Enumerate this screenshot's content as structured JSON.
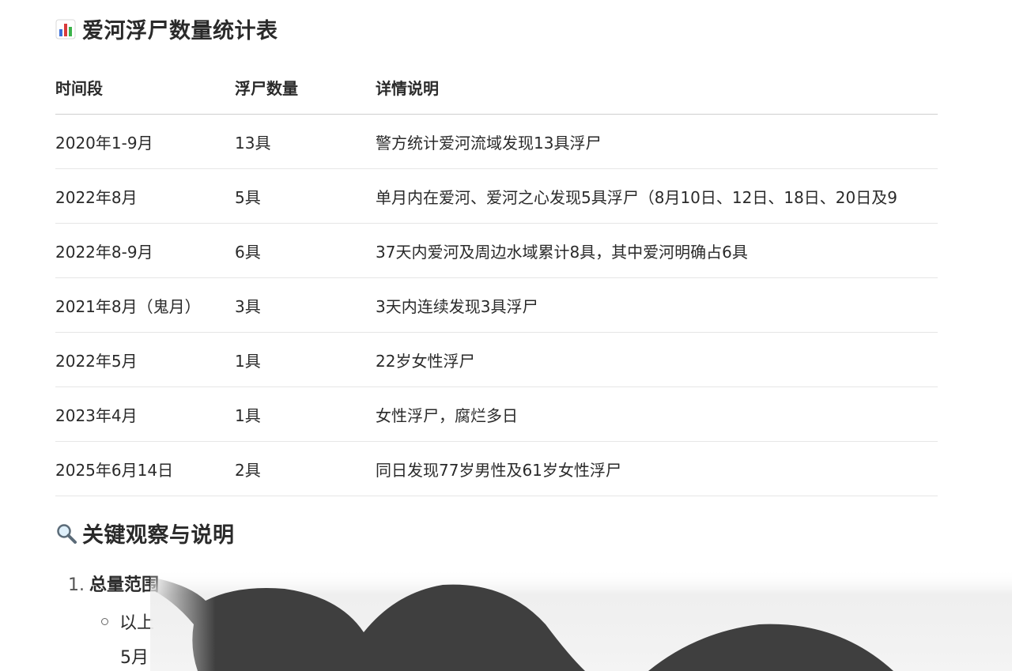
{
  "table_section": {
    "heading": "爱河浮尸数量统计表",
    "columns": [
      "时间段",
      "浮尸数量",
      "详情说明"
    ],
    "rows": [
      {
        "period": "2020年1-9月",
        "count": "13具",
        "detail": "警方统计爱河流域发现13具浮尸"
      },
      {
        "period": "2022年8月",
        "count": "5具",
        "detail": "单月内在爱河、爱河之心发现5具浮尸（8月10日、12日、18日、20日及9"
      },
      {
        "period": "2022年8-9月",
        "count": "6具",
        "detail": "37天内爱河及周边水域累计8具，其中爱河明确占6具"
      },
      {
        "period": "2021年8月（鬼月）",
        "count": "3具",
        "detail": "3天内连续发现3具浮尸"
      },
      {
        "period": "2022年5月",
        "count": "1具",
        "detail": "22岁女性浮尸"
      },
      {
        "period": "2023年4月",
        "count": "1具",
        "detail": "女性浮尸，腐烂多日"
      },
      {
        "period": "2025年6月14日",
        "count": "2具",
        "detail": "同日发现77岁男性及61岁女性浮尸"
      }
    ]
  },
  "notes_section": {
    "heading": "关键观察与说明",
    "items": [
      {
        "number": "1.",
        "title": "总量范围",
        "sub": "以上",
        "sub_cont": "5月"
      }
    ]
  },
  "icons": {
    "table_heading_icon": "bar-chart-icon",
    "notes_heading_icon": "magnifier-icon"
  },
  "colors": {
    "text": "#2a2a2a",
    "divider": "#e6e6e6",
    "header_divider": "#cfcfcf",
    "obstruction": "#3f3f3f"
  }
}
